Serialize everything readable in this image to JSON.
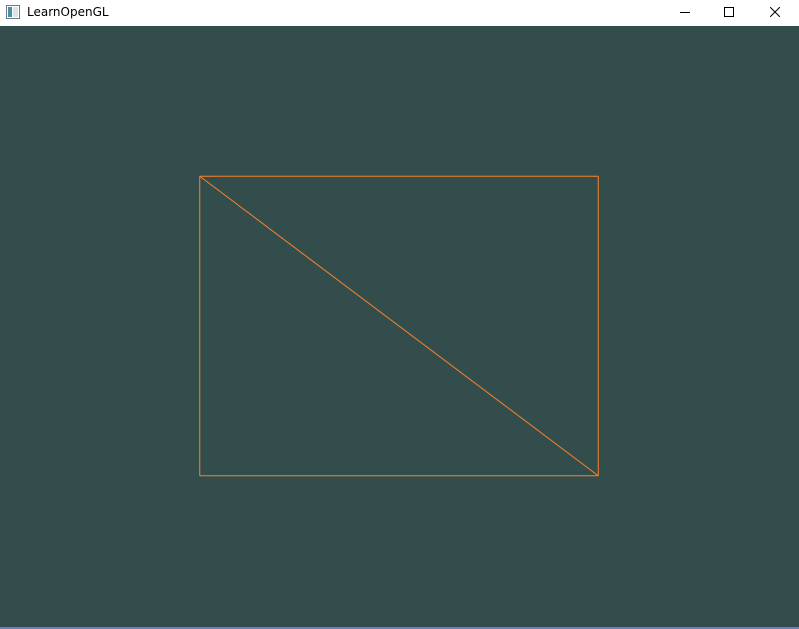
{
  "window": {
    "title": "LearnOpenGL",
    "app_icon": "window-app-icon",
    "buttons": {
      "minimize": {
        "icon": "minimize-icon"
      },
      "maximize": {
        "icon": "maximize-icon"
      },
      "close": {
        "icon": "close-icon"
      }
    }
  },
  "colors": {
    "clear_color": "#334d4d",
    "wireframe": "#ff8026",
    "window_border": "#6f7fb3"
  },
  "scene": {
    "polygon_mode": "wireframe",
    "vertices": [
      [
        0.5,
        0.5
      ],
      [
        0.5,
        -0.5
      ],
      [
        -0.5,
        -0.5
      ],
      [
        -0.5,
        0.5
      ]
    ],
    "triangles": [
      [
        0,
        1,
        3
      ],
      [
        1,
        2,
        3
      ]
    ]
  }
}
